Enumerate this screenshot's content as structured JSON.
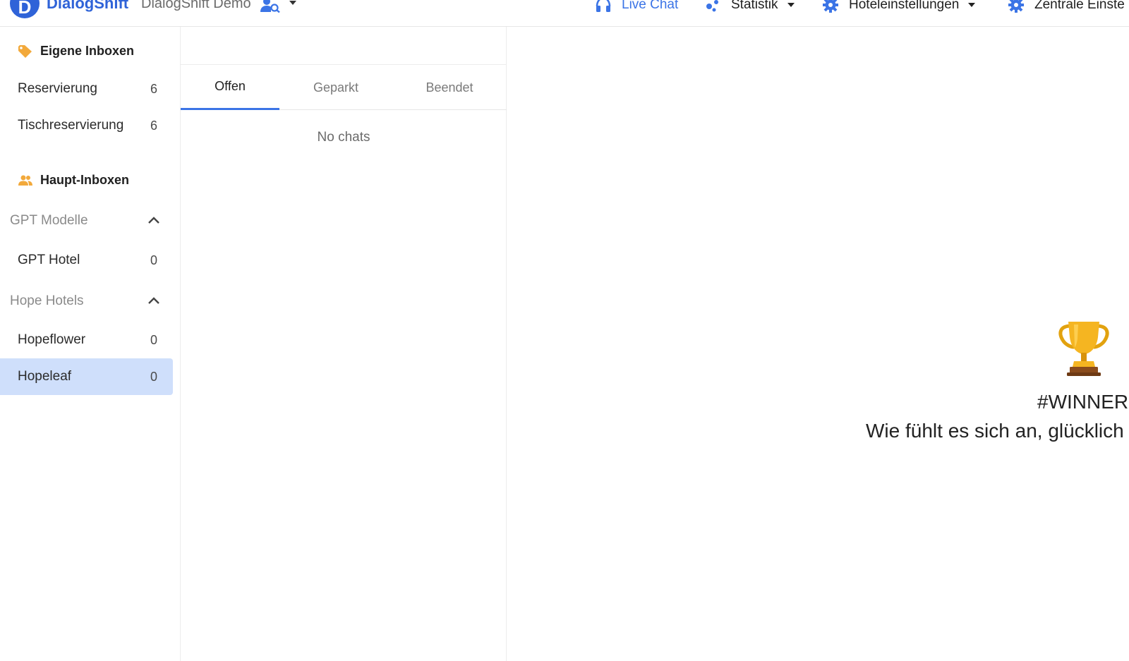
{
  "header": {
    "logo_letter": "D",
    "brand": "DialogShift",
    "workspace": "DialogShift Demo",
    "nav": [
      {
        "label": "Live Chat",
        "icon": "headset-icon",
        "active": true
      },
      {
        "label": "Statistik",
        "icon": "chart-dots-icon",
        "dropdown": true
      },
      {
        "label": "Hoteleinstellungen",
        "icon": "gear-icon",
        "dropdown": true
      },
      {
        "label": "Zentrale Einste",
        "icon": "gear-icon"
      }
    ],
    "colors": {
      "accent": "#3b74e6",
      "brand": "#2f63d8"
    }
  },
  "sidebar": {
    "own_section": {
      "label": "Eigene Inboxen",
      "icon": "tag-icon"
    },
    "own_inboxes": [
      {
        "label": "Reservierung",
        "count": "6"
      },
      {
        "label": "Tischreservierung",
        "count": "6"
      }
    ],
    "main_section": {
      "label": "Haupt-Inboxen",
      "icon": "people-icon"
    },
    "groups": [
      {
        "label": "GPT Modelle",
        "expanded": true,
        "inboxes": [
          {
            "label": "GPT Hotel",
            "count": "0"
          }
        ]
      },
      {
        "label": "Hope Hotels",
        "expanded": true,
        "inboxes": [
          {
            "label": "Hopeflower",
            "count": "0"
          },
          {
            "label": "Hopeleaf",
            "count": "0",
            "selected": true
          }
        ]
      }
    ],
    "selected_color": "#cfdffb"
  },
  "chatlist": {
    "tabs": [
      {
        "label": "Offen",
        "active": true
      },
      {
        "label": "Geparkt"
      },
      {
        "label": "Beendet"
      }
    ],
    "empty_text": "No chats"
  },
  "main": {
    "icon": "trophy-icon",
    "heading": "#WINNER",
    "text": "Wie fühlt es sich an, glücklich"
  }
}
